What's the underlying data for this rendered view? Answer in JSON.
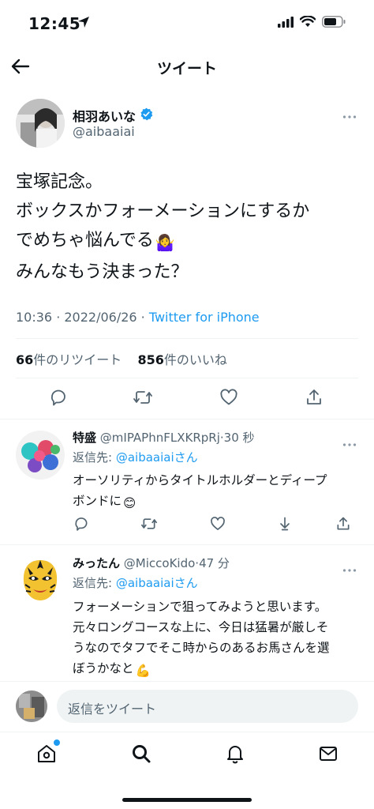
{
  "status_bar": {
    "time": "12:45"
  },
  "nav": {
    "title": "ツイート"
  },
  "main_tweet": {
    "author_name": "相羽あいな",
    "author_handle": "@aibaaiai",
    "text_lines": [
      "宝塚記念。",
      "ボックスかフォーメーションにするか",
      "でめちゃ悩んでる",
      "みんなもう決まった？"
    ],
    "emoji": "🤷‍♀️",
    "timestamp": "10:36 · 2022/06/26 · ",
    "source": "Twitter for iPhone",
    "retweet_count": "66",
    "retweet_label": "件のリツイート",
    "like_count": "856",
    "like_label": "件のいいね"
  },
  "replies": [
    {
      "name": "特盛",
      "handle": "@mIPAPhnFLXKRpRj",
      "time": "30 秒",
      "reply_to_label": "返信先: ",
      "reply_to_link": "@aibaaiaiさん",
      "text_lines": [
        "オーソリティからタイトルホルダーとディープ",
        "ボンドに"
      ],
      "emoji": "😊"
    },
    {
      "name": "みったん",
      "handle": "@MiccoKido",
      "time": "47 分",
      "reply_to_label": "返信先: ",
      "reply_to_link": "@aibaaiaiさん",
      "text_lines": [
        "フォーメーションで狙ってみようと思います。",
        "元々ロングコースな上に、今日は猛暑が厳しそ",
        "うなのでタフでそこ時からのあるお馬さんを選",
        "ぼうかなと"
      ],
      "emoji": "💪"
    }
  ],
  "compose": {
    "placeholder": "返信をツイート"
  },
  "colors": {
    "accent": "#1d9bf0",
    "text": "#0f1419",
    "secondary": "#536471",
    "divider": "#eff3f4"
  }
}
